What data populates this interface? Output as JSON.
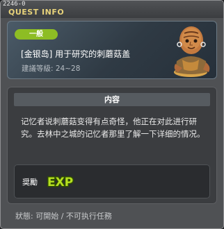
{
  "window": {
    "id": "2246-0",
    "title": "QUEST INFO"
  },
  "quest": {
    "category": "一般",
    "name": "[金银岛] 用于研究的刺蘑菇盖",
    "level": "建議等級: 24~28"
  },
  "content": {
    "header": "内容",
    "description": "记忆者说刺蘑菇变得有点奇怪，他正在对此进行研究。去林中之城的记忆者那里了解一下详细的情况。"
  },
  "reward": {
    "label": "奨勵",
    "icon": "exp-icon",
    "icon_text": "EXP"
  },
  "status": {
    "text": "狀態: 可開始 / 不可执行任務"
  },
  "colors": {
    "title": "#e7d27a",
    "badge": "#8dbd24",
    "exp": "#b6e020"
  }
}
